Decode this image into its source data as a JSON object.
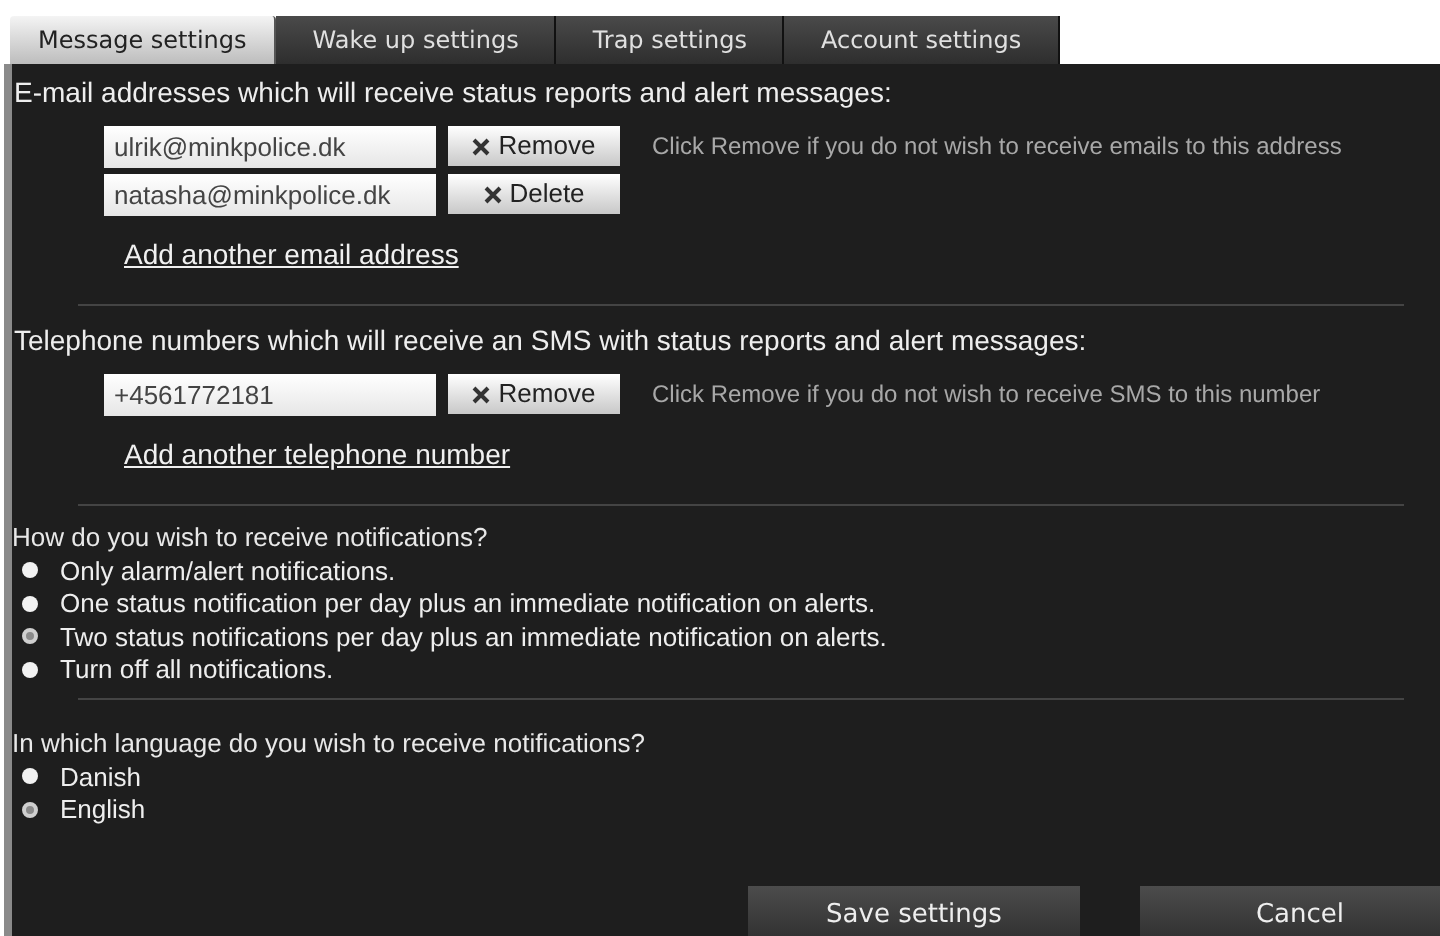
{
  "tabs": [
    {
      "label": "Message settings",
      "selected": true
    },
    {
      "label": "Wake up settings",
      "selected": false
    },
    {
      "label": "Trap settings",
      "selected": false
    },
    {
      "label": "Account settings",
      "selected": false
    }
  ],
  "email_section": {
    "heading": "E-mail addresses which will receive status reports and alert messages:",
    "entries": [
      {
        "value": "ulrik@minkpolice.dk",
        "button": "Remove",
        "hint": "Click Remove if you do not wish to receive emails to this address"
      },
      {
        "value": "natasha@minkpolice.dk",
        "button": "Delete"
      }
    ],
    "add_link": "Add another email address"
  },
  "phone_section": {
    "heading": "Telephone numbers which will receive an SMS with status reports and alert messages:",
    "entries": [
      {
        "value": "+4561772181",
        "button": "Remove",
        "hint": "Click Remove if you do not wish to receive SMS to this number"
      }
    ],
    "add_link": "Add another telephone number"
  },
  "notification_question": {
    "heading": "How do you wish to receive notifications?",
    "options": [
      {
        "label": "Only alarm/alert notifications.",
        "selected": false
      },
      {
        "label": "One status notification per day plus an immediate notification on alerts.",
        "selected": false
      },
      {
        "label": "Two status notifications per day plus an immediate notification on alerts.",
        "selected": true
      },
      {
        "label": "Turn off all notifications.",
        "selected": false
      }
    ]
  },
  "language_question": {
    "heading": "In which language do you wish to receive notifications?",
    "options": [
      {
        "label": "Danish",
        "selected": false
      },
      {
        "label": "English",
        "selected": true
      }
    ]
  },
  "buttons": [
    "Save settings",
    "Cancel"
  ]
}
